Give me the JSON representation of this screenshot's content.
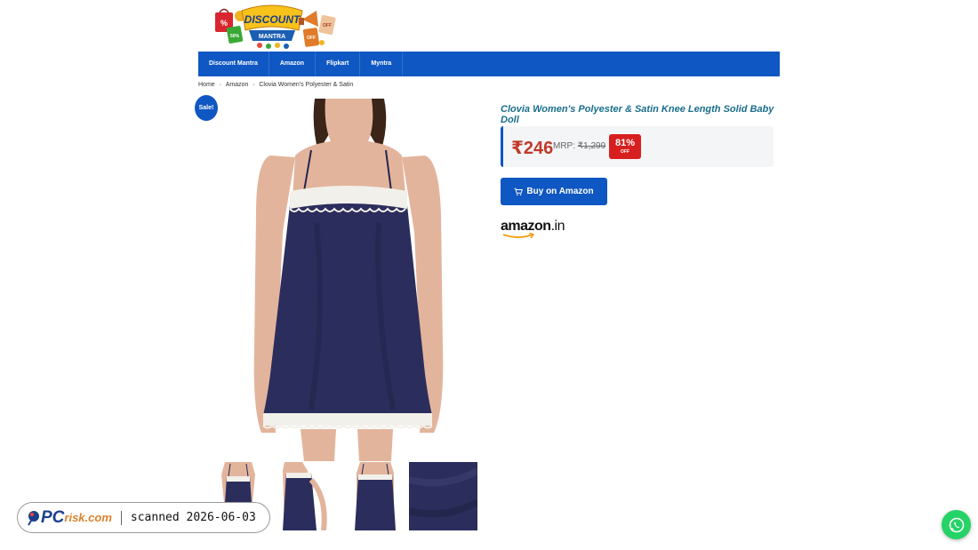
{
  "logo": {
    "line1": "DISCOUNT",
    "line2": "MANTRA",
    "bag_labels": [
      "%",
      "50%",
      "OFF",
      "OFF"
    ]
  },
  "nav": {
    "items": [
      "Discount Mantra",
      "Amazon",
      "Flipkart",
      "Myntra"
    ]
  },
  "breadcrumb": {
    "home": "Home",
    "category": "Amazon",
    "current": "Clovia Women's Polyester & Satin"
  },
  "sale_badge": "Sale!",
  "product": {
    "title": "Clovia Women's Polyester & Satin Knee Length Solid Baby Doll",
    "price": "₹246",
    "mrp_label": "MRP:",
    "mrp_value": "₹1,299",
    "discount_percent": "81%",
    "discount_off": "OFF",
    "buy_label": "Buy on Amazon",
    "store_logo": {
      "main": "amazon",
      "suffix": ".in"
    },
    "garment_color": "#2b2e5c"
  },
  "watermark": {
    "brand_pc": "PC",
    "brand_risk": "risk.com",
    "text": "scanned 2026-06-03"
  },
  "colors": {
    "nav": "#0f57c2",
    "title": "#1a6e8c",
    "price": "#c0392b",
    "off_badge": "#d81f1f",
    "whatsapp": "#25d366"
  }
}
